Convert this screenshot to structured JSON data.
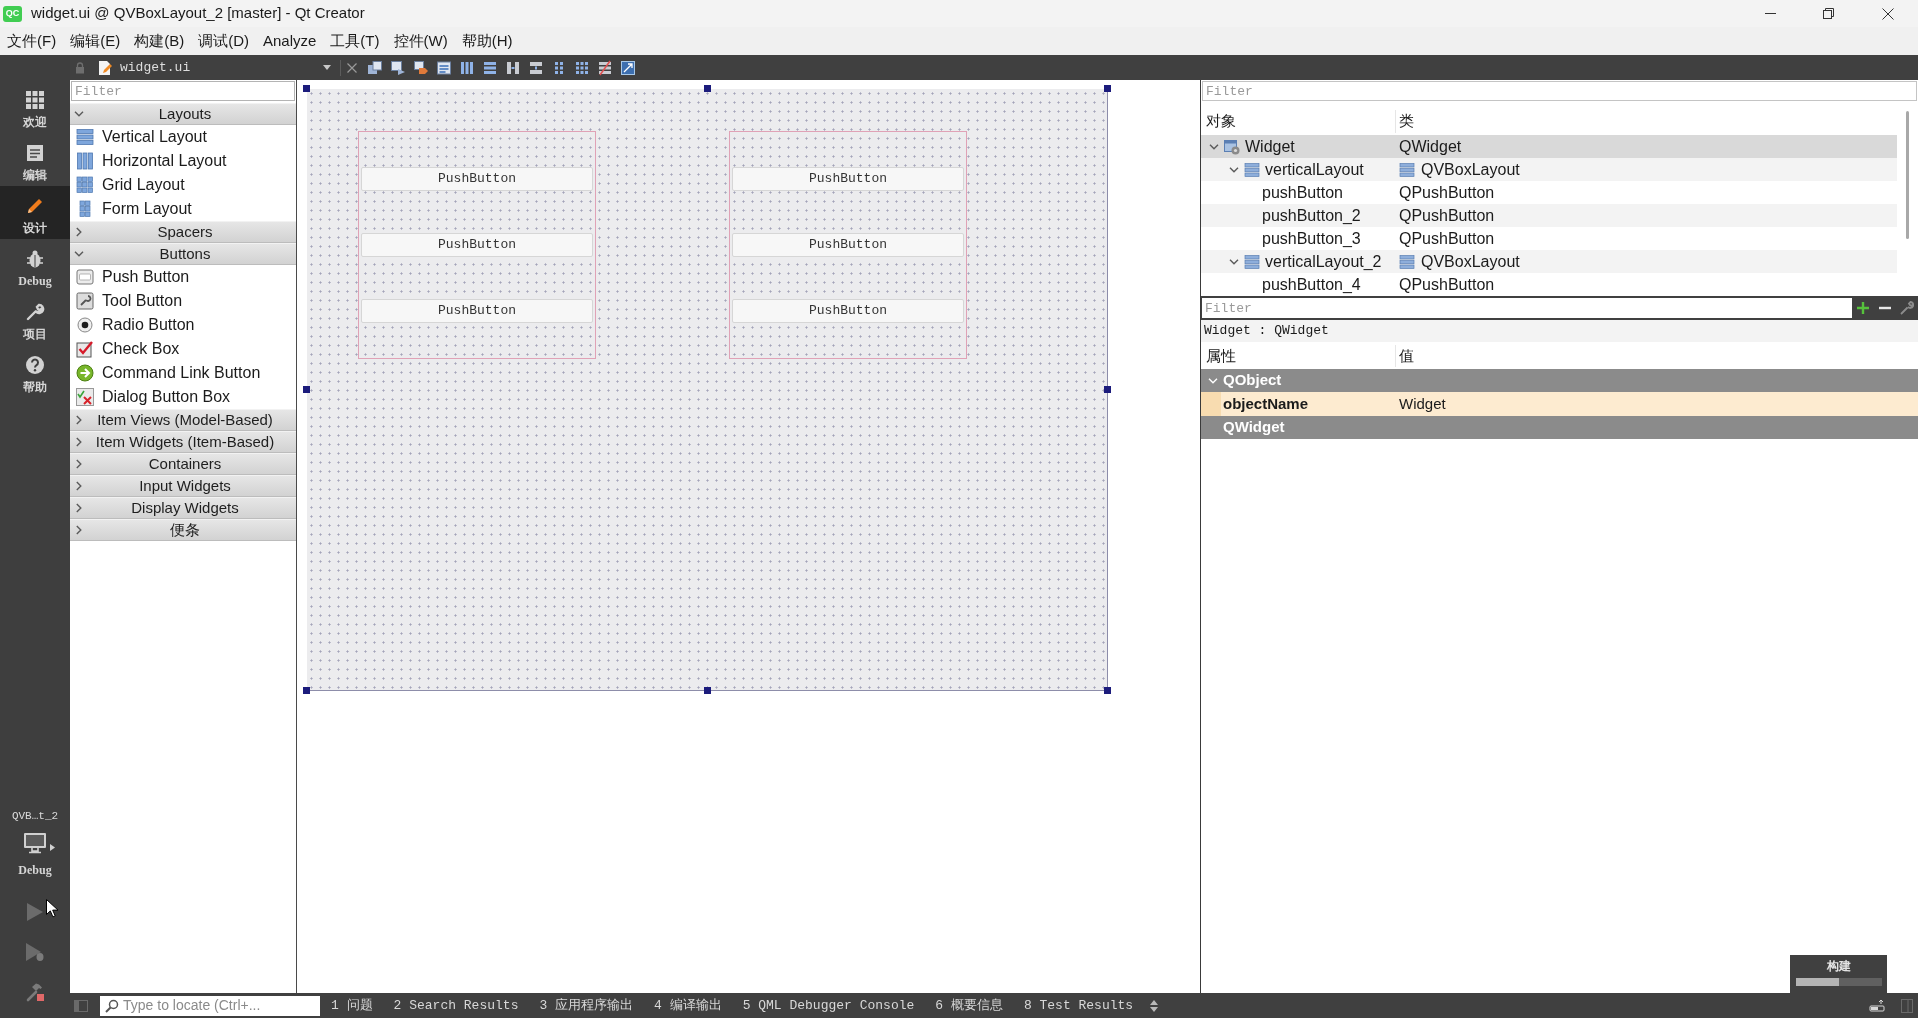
{
  "window": {
    "logo": "QC",
    "title": "widget.ui @ QVBoxLayout_2 [master] - Qt Creator"
  },
  "menu": [
    "文件(F)",
    "编辑(E)",
    "构建(B)",
    "调试(D)",
    "Analyze",
    "工具(T)",
    "控件(W)",
    "帮助(H)"
  ],
  "mode_bar": {
    "modes": [
      {
        "label": "欢迎",
        "selected": false
      },
      {
        "label": "编辑",
        "selected": false
      },
      {
        "label": "设计",
        "selected": true
      },
      {
        "label": "Debug",
        "selected": false
      },
      {
        "label": "项目",
        "selected": false
      },
      {
        "label": "帮助",
        "selected": false
      }
    ],
    "project": "QVB…t_2",
    "build_config": "Debug"
  },
  "editor_toolbar": {
    "file": "widget.ui"
  },
  "widget_box": {
    "filter_placeholder": "Filter",
    "categories": [
      {
        "label": "Layouts",
        "expanded": true,
        "items": [
          "Vertical Layout",
          "Horizontal Layout",
          "Grid Layout",
          "Form Layout"
        ]
      },
      {
        "label": "Spacers",
        "expanded": false
      },
      {
        "label": "Buttons",
        "expanded": true,
        "items": [
          "Push Button",
          "Tool Button",
          "Radio Button",
          "Check Box",
          "Command Link Button",
          "Dialog Button Box"
        ]
      },
      {
        "label": "Item Views (Model-Based)",
        "expanded": false
      },
      {
        "label": "Item Widgets (Item-Based)",
        "expanded": false
      },
      {
        "label": "Containers",
        "expanded": false
      },
      {
        "label": "Input Widgets",
        "expanded": false
      },
      {
        "label": "Display Widgets",
        "expanded": false
      },
      {
        "label": "便条",
        "expanded": false
      }
    ]
  },
  "form": {
    "layouts": [
      {
        "buttons": [
          "PushButton",
          "PushButton",
          "PushButton"
        ]
      },
      {
        "buttons": [
          "PushButton",
          "PushButton",
          "PushButton"
        ]
      }
    ]
  },
  "object_inspector": {
    "filter_placeholder": "Filter",
    "columns": [
      "对象",
      "类"
    ],
    "tree": [
      {
        "kind": "widget",
        "name": "Widget",
        "class": "QWidget",
        "selected": true,
        "expanded": true,
        "children": [
          {
            "kind": "layout",
            "name": "verticalLayout",
            "class": "QVBoxLayout",
            "selected": false,
            "expanded": true,
            "children": [
              {
                "name": "pushButton",
                "class": "QPushButton",
                "selected": false,
                "expanded": false
              },
              {
                "name": "pushButton_2",
                "class": "QPushButton",
                "selected": false,
                "expanded": false
              },
              {
                "name": "pushButton_3",
                "class": "QPushButton",
                "selected": false,
                "expanded": false
              }
            ]
          },
          {
            "kind": "layout",
            "name": "verticalLayout_2",
            "class": "QVBoxLayout",
            "selected": false,
            "expanded": true,
            "children": [
              {
                "name": "pushButton_4",
                "class": "QPushButton",
                "selected": false,
                "expanded": false
              }
            ]
          }
        ]
      }
    ]
  },
  "property_editor": {
    "filter_placeholder": "Filter",
    "caption": "Widget : QWidget",
    "columns": [
      "属性",
      "值"
    ],
    "sections": [
      {
        "name": "QObject",
        "expanded": true,
        "properties": [
          {
            "name": "objectName",
            "value": "Widget"
          }
        ]
      },
      {
        "name": "QWidget",
        "expanded": false
      }
    ]
  },
  "status_bar": {
    "locator_placeholder": "Type to locate (Ctrl+...",
    "panes": [
      "1 问题",
      "2 Search Results",
      "3 应用程序输出",
      "4 编译输出",
      "5 QML Debugger Console",
      "6 概要信息",
      "8 Test Results"
    ]
  },
  "build_progress": {
    "label": "构建",
    "level": 0.5
  }
}
